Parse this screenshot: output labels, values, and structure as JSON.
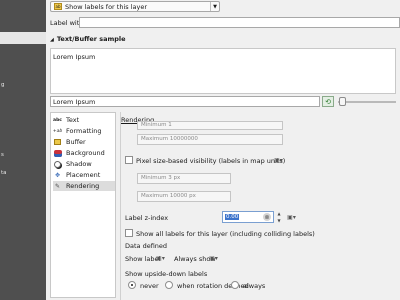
{
  "left_panel": {
    "items": [
      "g",
      "",
      "",
      "ta",
      "s",
      ""
    ]
  },
  "top": {
    "mode_select": "Show labels for this layer",
    "label_with": "Label with",
    "sample_group_title": "Text/Buffer sample"
  },
  "sample": {
    "preview_text": "Lorem Ipsum",
    "input_value": "Lorem Ipsum"
  },
  "tabs": [
    {
      "label": "Text",
      "icon": "abc-icon"
    },
    {
      "label": "Formatting",
      "icon": "formatting-icon"
    },
    {
      "label": "Buffer",
      "icon": "buffer-icon"
    },
    {
      "label": "Background",
      "icon": "background-icon"
    },
    {
      "label": "Shadow",
      "icon": "shadow-icon"
    },
    {
      "label": "Placement",
      "icon": "placement-icon"
    },
    {
      "label": "Rendering",
      "icon": "rendering-icon"
    }
  ],
  "rendering": {
    "heading": "Rendering",
    "minimum_placeholder": "Minimum 1",
    "maximum_placeholder": "Maximum 10000000",
    "pixel_visibility_label": "Pixel size-based visibility (labels in map units)",
    "min_px_placeholder": "Minimum 3 px",
    "max_px_placeholder": "Maximum 10000 px",
    "zindex_label": "Label z-index",
    "zindex_value": "0.00",
    "show_all_label": "Show all labels for this layer (including colliding labels)",
    "data_defined_label": "Data defined",
    "show_label": "Show label",
    "always_show": "Always show",
    "upside_down_label": "Show upside-down labels",
    "upside_options": [
      "never",
      "when rotation defined",
      "always"
    ]
  },
  "colors": {
    "accent": "#3d74cc",
    "sidebar": "#4f4f4f"
  }
}
